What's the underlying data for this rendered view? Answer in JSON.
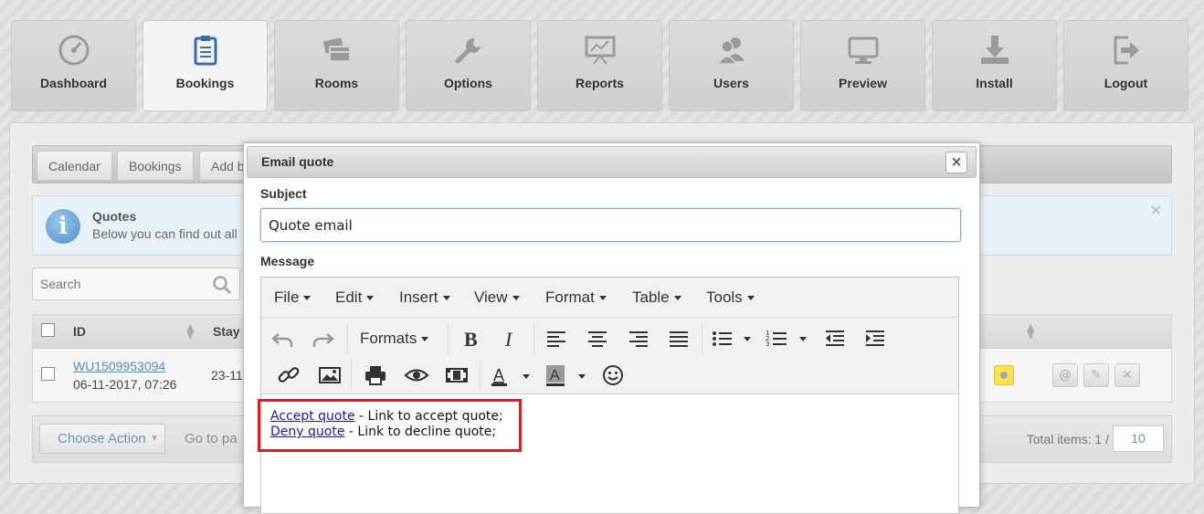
{
  "nav": {
    "tabs": [
      {
        "label": "Dashboard",
        "icon": "dashboard-icon"
      },
      {
        "label": "Bookings",
        "icon": "clipboard-icon",
        "active": true
      },
      {
        "label": "Rooms",
        "icon": "rooms-icon"
      },
      {
        "label": "Options",
        "icon": "wrench-icon"
      },
      {
        "label": "Reports",
        "icon": "presentation-chart-icon"
      },
      {
        "label": "Users",
        "icon": "users-icon"
      },
      {
        "label": "Preview",
        "icon": "monitor-icon"
      },
      {
        "label": "Install",
        "icon": "download-icon"
      },
      {
        "label": "Logout",
        "icon": "logout-icon"
      }
    ]
  },
  "subtabs": [
    "Calendar",
    "Bookings",
    "Add b"
  ],
  "info": {
    "title": "Quotes",
    "text": "Below you can find out all"
  },
  "search": {
    "placeholder": "Search"
  },
  "table": {
    "headers": {
      "id": "ID",
      "stay": "Stay"
    },
    "row": {
      "id": "WU1509953094",
      "date": "06-11-2017, 07:26",
      "stay": "23-11"
    }
  },
  "footer": {
    "choose_action": "Choose Action",
    "goto": "Go to pa",
    "total": "Total items: 1 /",
    "per_page": "10"
  },
  "modal": {
    "title": "Email quote",
    "close": "×",
    "subject_label": "Subject",
    "subject_value": "Quote email",
    "message_label": "Message",
    "menu": [
      "File",
      "Edit",
      "Insert",
      "View",
      "Format",
      "Table",
      "Tools"
    ],
    "formats_label": "Formats",
    "content": {
      "accept_link": "Accept quote",
      "accept_text": " - Link to accept quote;",
      "deny_link": "Deny quote",
      "deny_text": " - Link to decline quote;"
    }
  },
  "colors": {
    "highlight": "#d2232a",
    "link": "#1a1aa6",
    "accent": "#6b95b6"
  }
}
